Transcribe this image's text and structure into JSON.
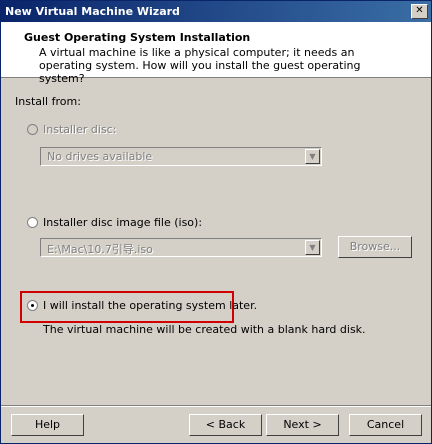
{
  "window": {
    "title": "New Virtual Machine Wizard",
    "close_glyph": "✕"
  },
  "header": {
    "title": "Guest Operating System Installation",
    "description": "A virtual machine is like a physical computer; it needs an operating system. How will you install the guest operating system?"
  },
  "install_from": {
    "label": "Install from:",
    "disc": {
      "label": "Installer disc:",
      "value": "No drives available",
      "enabled": false,
      "selected": false
    },
    "iso": {
      "label": "Installer disc image file (iso):",
      "value": "E:\\Mac\\10.7引导.iso",
      "browse_label": "Browse...",
      "enabled": false,
      "selected": false
    },
    "later": {
      "label": "I will install the operating system later.",
      "description": "The virtual machine will be created with a blank hard disk.",
      "selected": true
    }
  },
  "footer": {
    "help_label": "Help",
    "back_label": "< Back",
    "next_label": "Next >",
    "cancel_label": "Cancel"
  },
  "colors": {
    "highlight": "#d00000",
    "title_gradient_start": "#0a246a",
    "title_gradient_end": "#3a6ea5"
  }
}
